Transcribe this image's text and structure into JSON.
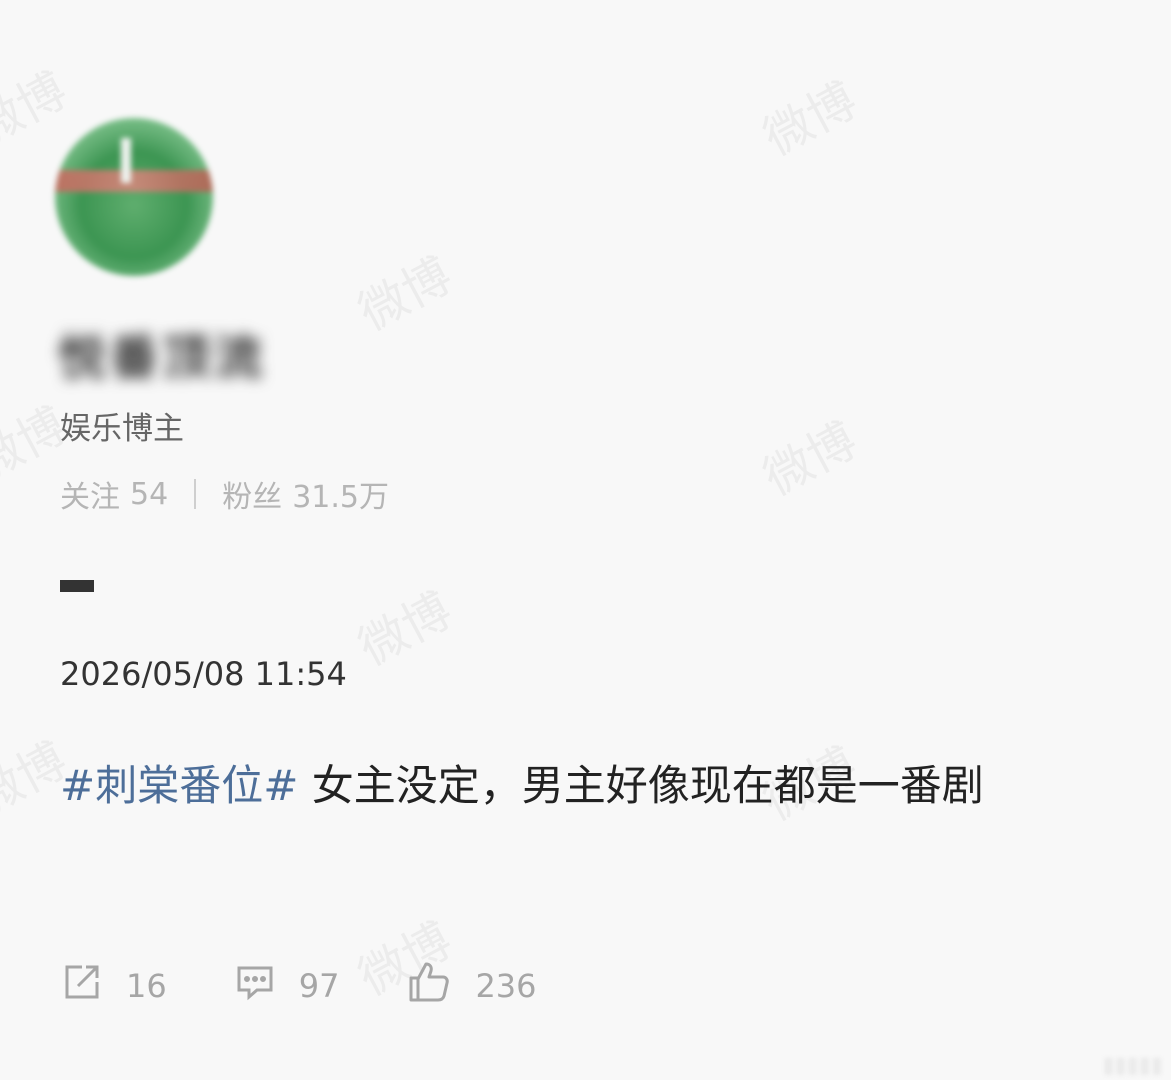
{
  "watermark": "微博",
  "profile": {
    "username": "悦番顶流",
    "verify_label": "娱乐博主",
    "following_label": "关注",
    "following_count": "54",
    "followers_label": "粉丝",
    "followers_count": "31.5万"
  },
  "post": {
    "timestamp": "2026/05/08 11:54",
    "hashtag": "#刺棠番位#",
    "text": " 女主没定，男主好像现在都是一番剧"
  },
  "actions": {
    "share_count": "16",
    "comment_count": "97",
    "like_count": "236"
  },
  "icons": [
    "share-icon",
    "comment-icon",
    "like-icon"
  ],
  "colors": {
    "hashtag": "#4d6e99",
    "muted": "#a6a6a6",
    "background": "#f8f8f8"
  }
}
